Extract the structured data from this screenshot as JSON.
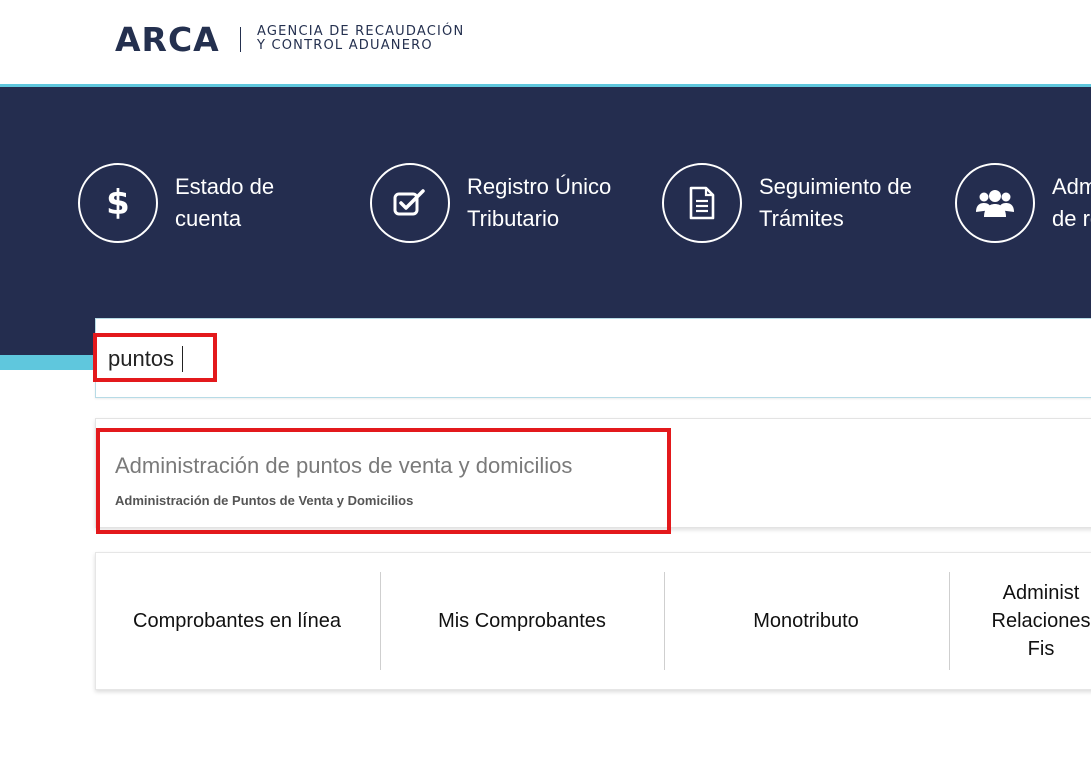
{
  "header": {
    "logo": "ARCA",
    "agency_line1": "AGENCIA DE RECAUDACIÓN",
    "agency_line2": "Y CONTROL ADUANERO"
  },
  "shortcuts": [
    {
      "icon": "dollar-icon",
      "line1": "Estado de",
      "line2": "cuenta"
    },
    {
      "icon": "checkbox-icon",
      "line1": "Registro Único",
      "line2": "Tributario"
    },
    {
      "icon": "document-icon",
      "line1": "Seguimiento de",
      "line2": "Trámites"
    },
    {
      "icon": "users-icon",
      "line1": "Adm",
      "line2": "de re"
    }
  ],
  "search": {
    "value": "puntos"
  },
  "suggestion": {
    "title": "Administración de puntos de venta y domicilios",
    "subtitle": "Administración de Puntos de Venta y Domicilios"
  },
  "quick_links": [
    {
      "label": "Comprobantes en línea"
    },
    {
      "label": "Mis Comprobantes"
    },
    {
      "label": "Monotributo"
    },
    {
      "line1": "Administ",
      "line2": "Relaciones",
      "line3": "Fis"
    }
  ],
  "colors": {
    "navy": "#242d4f",
    "accent_cyan": "#5fc7dd",
    "highlight_red": "#e3191c"
  }
}
